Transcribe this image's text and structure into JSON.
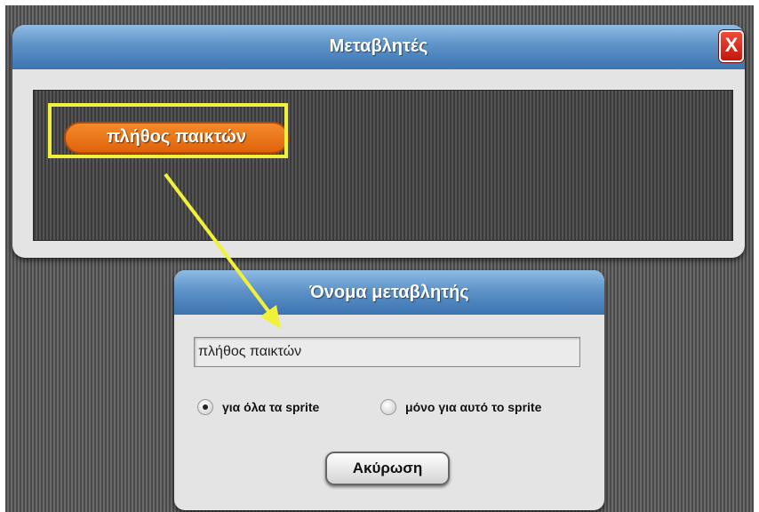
{
  "variables_dialog": {
    "title": "Μεταβλητές",
    "close_label": "X",
    "variable_block": "πλήθος παικτών"
  },
  "name_dialog": {
    "title": "Όνομα μεταβλητής",
    "name_value": "πλήθος παικτών",
    "radio_all": "για όλα τα sprite",
    "radio_this": "μόνο για αυτό το sprite",
    "radio_all_selected": true,
    "cancel_label": "Ακύρωση"
  },
  "colors": {
    "titlebar": "#5e93c8",
    "variable_block": "#e0630c",
    "highlight": "#f1f03a",
    "close_button": "#c4170c"
  }
}
